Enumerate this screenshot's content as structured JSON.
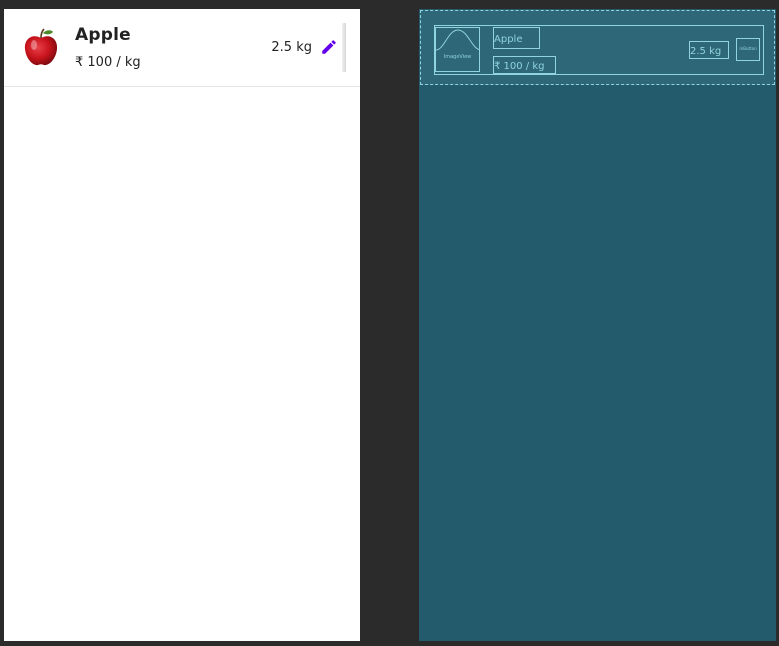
{
  "item": {
    "name": "Apple",
    "price": "₹ 100 / kg",
    "quantity": "2.5 kg",
    "image_icon": "apple-image",
    "edit_icon": "pencil-icon"
  },
  "blueprint": {
    "name_text": "Apple",
    "price_text": "₹ 100 / kg",
    "quantity_text": "2.5 kg"
  },
  "colors": {
    "editor_background": "#2b2b2c",
    "blueprint_background": "#245b6c",
    "blueprint_line": "#8fd4de",
    "edit_icon": "#6200ee",
    "apple_red": "#c9141c"
  }
}
